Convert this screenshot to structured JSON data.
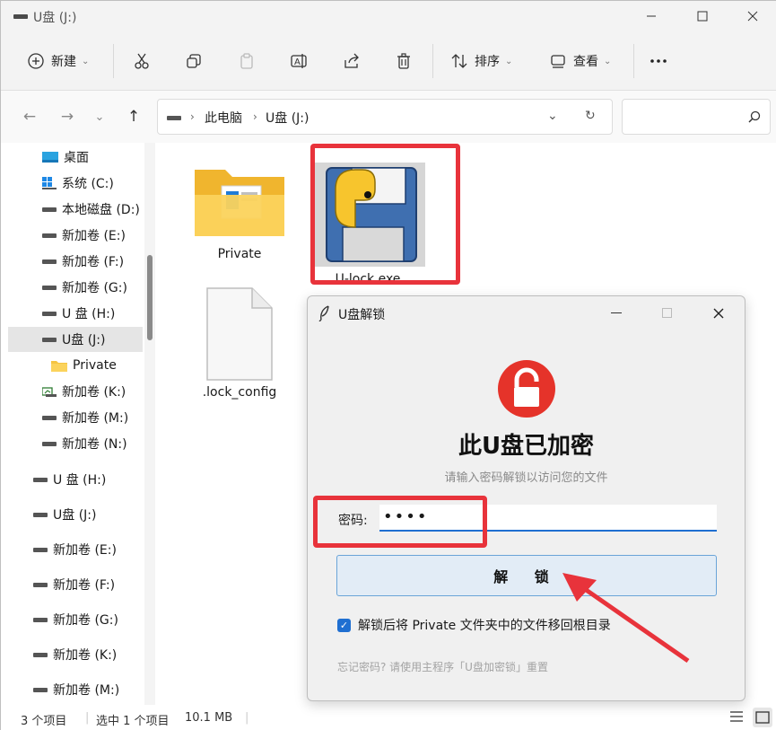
{
  "window": {
    "tab_title": "U盘 (J:)"
  },
  "toolbar": {
    "new_label": "新建",
    "sort_label": "排序",
    "view_label": "查看"
  },
  "address": {
    "crumbs": [
      "此电脑",
      "U盘 (J:)"
    ]
  },
  "sidebar": {
    "items": [
      {
        "label": "桌面",
        "icon": "desktop-icon"
      },
      {
        "label": "系统 (C:)",
        "icon": "windows-drive-icon"
      },
      {
        "label": "本地磁盘 (D:)",
        "icon": "drive-icon"
      },
      {
        "label": "新加卷 (E:)",
        "icon": "drive-icon"
      },
      {
        "label": "新加卷 (F:)",
        "icon": "drive-icon"
      },
      {
        "label": "新加卷 (G:)",
        "icon": "drive-icon"
      },
      {
        "label": "U 盘 (H:)",
        "icon": "drive-icon"
      },
      {
        "label": "U盘 (J:)",
        "icon": "drive-icon",
        "selected": true
      },
      {
        "label": "Private",
        "icon": "folder-icon"
      },
      {
        "label": "新加卷 (K:)",
        "icon": "drive-icon"
      },
      {
        "label": "新加卷 (M:)",
        "icon": "drive-icon"
      },
      {
        "label": "新加卷 (N:)",
        "icon": "drive-icon"
      },
      {
        "label": "U 盘 (H:)",
        "icon": "drive-icon"
      },
      {
        "label": "U盘 (J:)",
        "icon": "drive-icon"
      },
      {
        "label": "新加卷 (E:)",
        "icon": "drive-icon"
      },
      {
        "label": "新加卷 (F:)",
        "icon": "drive-icon"
      },
      {
        "label": "新加卷 (G:)",
        "icon": "drive-icon"
      },
      {
        "label": "新加卷 (K:)",
        "icon": "drive-icon"
      },
      {
        "label": "新加卷 (M:)",
        "icon": "drive-icon"
      }
    ]
  },
  "files": [
    {
      "name": "Private",
      "icon": "folder-icon"
    },
    {
      "name": "U-lock.exe",
      "icon": "python-floppy-icon"
    },
    {
      "name": ".lock_config",
      "icon": "blank-file-icon"
    }
  ],
  "status": {
    "count": "3 个项目",
    "selection": "选中 1 个项目",
    "size": "10.1 MB"
  },
  "dialog": {
    "title": "U盘解锁",
    "heading": "此U盘已加密",
    "subtitle": "请输入密码解锁以访问您的文件",
    "password_label": "密码:",
    "password_value": "••••",
    "unlock_label": "解 锁",
    "checkbox_label": "解锁后将 Private 文件夹中的文件移回根目录",
    "hint": "忘记密码? 请使用主程序「U盘加密锁」重置"
  },
  "colors": {
    "highlight": "#e8333b",
    "accent": "#1f6fd1",
    "lock_red": "#e5332a"
  }
}
